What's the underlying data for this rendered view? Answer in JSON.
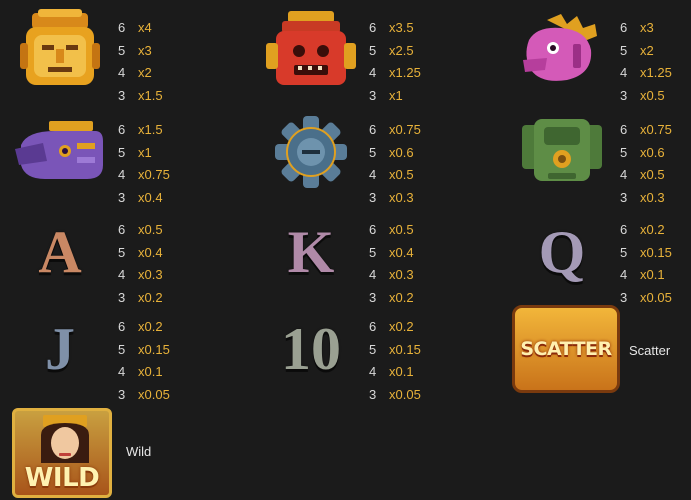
{
  "symbols": [
    {
      "name": "Yellow Mask",
      "color": "#e8a21f",
      "icon": "yellow-mask-icon",
      "pays": [
        {
          "n": "6",
          "x": "x4"
        },
        {
          "n": "5",
          "x": "x3"
        },
        {
          "n": "4",
          "x": "x2"
        },
        {
          "n": "3",
          "x": "x1.5"
        }
      ]
    },
    {
      "name": "Red Mask",
      "color": "#d83a2a",
      "icon": "red-mask-icon",
      "pays": [
        {
          "n": "6",
          "x": "x3.5"
        },
        {
          "n": "5",
          "x": "x2.5"
        },
        {
          "n": "4",
          "x": "x1.25"
        },
        {
          "n": "3",
          "x": "x1"
        }
      ]
    },
    {
      "name": "Pink Serpent",
      "color": "#d45ab8",
      "icon": "pink-serpent-icon",
      "pays": [
        {
          "n": "6",
          "x": "x3"
        },
        {
          "n": "5",
          "x": "x2"
        },
        {
          "n": "4",
          "x": "x1.25"
        },
        {
          "n": "3",
          "x": "x0.5"
        }
      ]
    },
    {
      "name": "Purple Serpent",
      "color": "#7a55b8",
      "icon": "purple-serpent-icon",
      "pays": [
        {
          "n": "6",
          "x": "x1.5"
        },
        {
          "n": "5",
          "x": "x1"
        },
        {
          "n": "4",
          "x": "x0.75"
        },
        {
          "n": "3",
          "x": "x0.4"
        }
      ]
    },
    {
      "name": "Blue Wheel",
      "color": "#4a6f8a",
      "icon": "blue-wheel-icon",
      "pays": [
        {
          "n": "6",
          "x": "x0.75"
        },
        {
          "n": "5",
          "x": "x0.6"
        },
        {
          "n": "4",
          "x": "x0.5"
        },
        {
          "n": "3",
          "x": "x0.3"
        }
      ]
    },
    {
      "name": "Green Idol",
      "color": "#4e7a3a",
      "icon": "green-idol-icon",
      "pays": [
        {
          "n": "6",
          "x": "x0.75"
        },
        {
          "n": "5",
          "x": "x0.6"
        },
        {
          "n": "4",
          "x": "x0.5"
        },
        {
          "n": "3",
          "x": "x0.3"
        }
      ]
    },
    {
      "name": "A",
      "letter": "A",
      "color": "#c98864",
      "icon": "letter-a-icon",
      "pays": [
        {
          "n": "6",
          "x": "x0.5"
        },
        {
          "n": "5",
          "x": "x0.4"
        },
        {
          "n": "4",
          "x": "x0.3"
        },
        {
          "n": "3",
          "x": "x0.2"
        }
      ]
    },
    {
      "name": "K",
      "letter": "K",
      "color": "#b08aa8",
      "icon": "letter-k-icon",
      "pays": [
        {
          "n": "6",
          "x": "x0.5"
        },
        {
          "n": "5",
          "x": "x0.4"
        },
        {
          "n": "4",
          "x": "x0.3"
        },
        {
          "n": "3",
          "x": "x0.2"
        }
      ]
    },
    {
      "name": "Q",
      "letter": "Q",
      "color": "#a49ab6",
      "icon": "letter-q-icon",
      "pays": [
        {
          "n": "6",
          "x": "x0.2"
        },
        {
          "n": "5",
          "x": "x0.15"
        },
        {
          "n": "4",
          "x": "x0.1"
        },
        {
          "n": "3",
          "x": "x0.05"
        }
      ]
    },
    {
      "name": "J",
      "letter": "J",
      "color": "#7f90a8",
      "icon": "letter-j-icon",
      "pays": [
        {
          "n": "6",
          "x": "x0.2"
        },
        {
          "n": "5",
          "x": "x0.15"
        },
        {
          "n": "4",
          "x": "x0.1"
        },
        {
          "n": "3",
          "x": "x0.05"
        }
      ]
    },
    {
      "name": "10",
      "letter": "10",
      "color": "#9aa092",
      "icon": "number-10-icon",
      "pays": [
        {
          "n": "6",
          "x": "x0.2"
        },
        {
          "n": "5",
          "x": "x0.15"
        },
        {
          "n": "4",
          "x": "x0.1"
        },
        {
          "n": "3",
          "x": "x0.05"
        }
      ]
    }
  ],
  "scatter": {
    "badge_text": "SCATTER",
    "caption": "Scatter",
    "color": "#e9a21c"
  },
  "wild": {
    "badge_text": "WILD",
    "caption": "Wild",
    "color": "#e9a21c"
  }
}
